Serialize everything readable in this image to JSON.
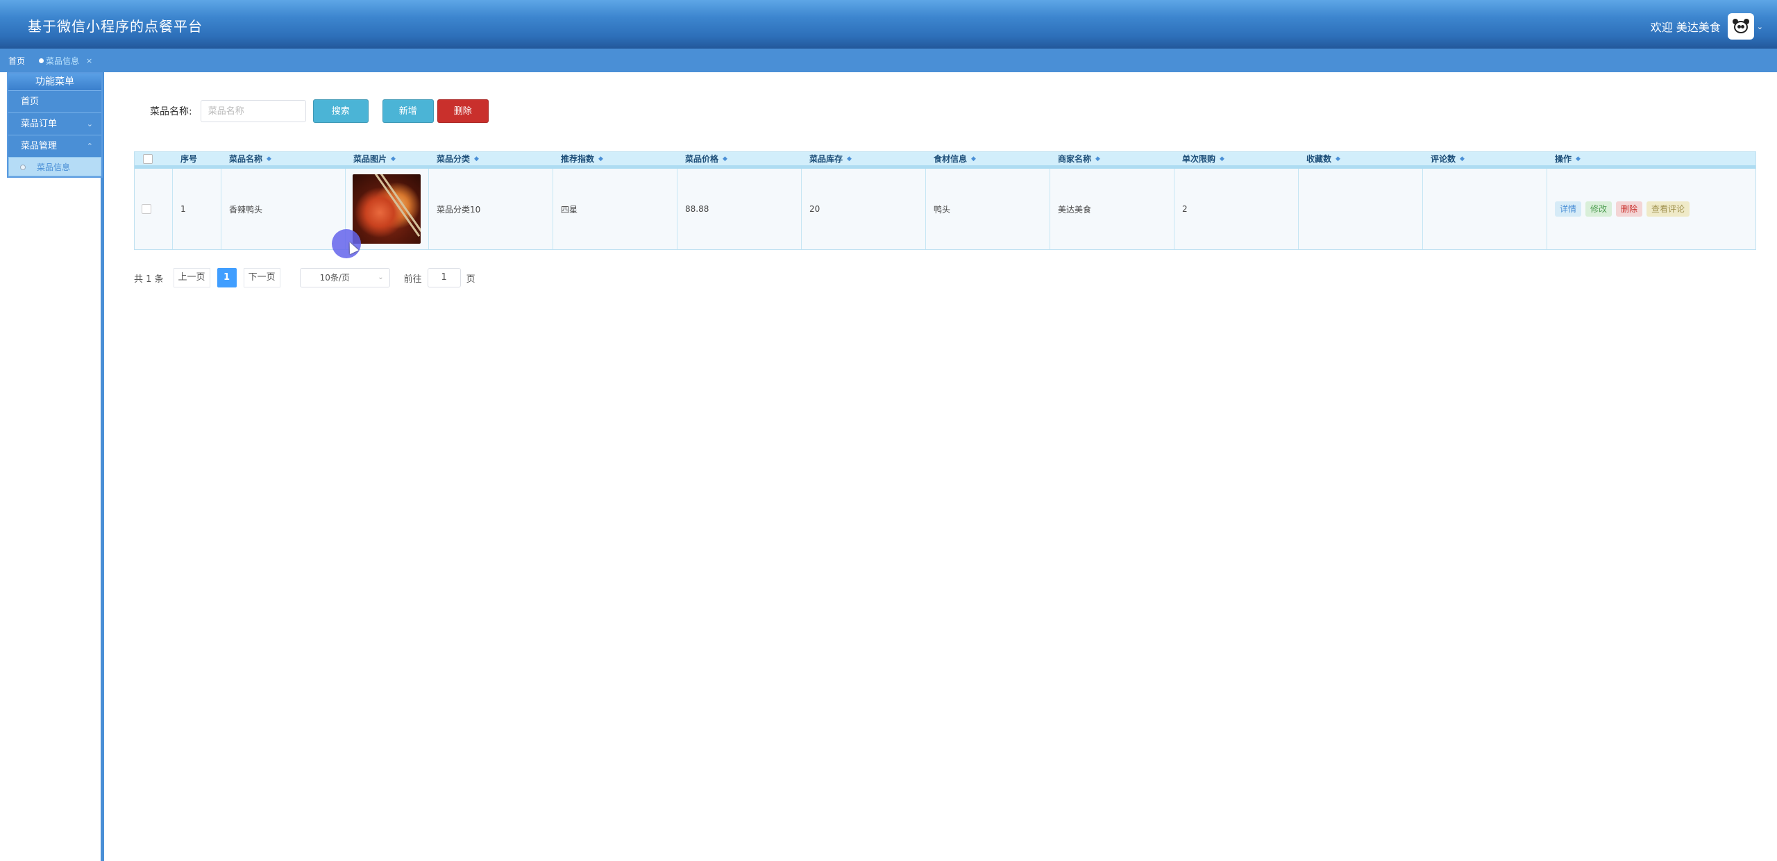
{
  "header": {
    "app_title": "基于微信小程序的点餐平台",
    "welcome_text": "欢迎 美达美食",
    "user_caret": "⌄"
  },
  "tabs": [
    {
      "label": "首页"
    },
    {
      "label": "菜品信息",
      "close": "×"
    }
  ],
  "sidebar": {
    "title": "功能菜单",
    "items": [
      {
        "label": "首页",
        "chevron": ""
      },
      {
        "label": "菜品订单",
        "chevron": "⌄"
      },
      {
        "label": "菜品管理",
        "chevron": "⌃"
      }
    ],
    "sub_items": [
      {
        "label": "菜品信息"
      }
    ]
  },
  "search": {
    "label": "菜品名称:",
    "placeholder": "菜品名称",
    "search_button": "搜索",
    "add_button": "新增",
    "delete_button": "删除"
  },
  "table": {
    "sort_glyph": "◆",
    "columns": [
      "序号",
      "菜品名称",
      "菜品图片",
      "菜品分类",
      "推荐指数",
      "菜品价格",
      "菜品库存",
      "食材信息",
      "商家名称",
      "单次限购",
      "收藏数",
      "评论数",
      "操作"
    ],
    "rows": [
      {
        "index": "1",
        "name": "香辣鸭头",
        "category": "菜品分类10",
        "recommend": "四星",
        "price": "88.88",
        "stock": "20",
        "ingredients": "鸭头",
        "merchant": "美达美食",
        "limit": "2",
        "favorites": "",
        "comments": ""
      }
    ],
    "actions": {
      "detail": "详情",
      "edit": "修改",
      "delete": "删除",
      "view_comments": "查看评论"
    }
  },
  "pagination": {
    "total": "共 1 条",
    "prev": "上一页",
    "current": "1",
    "next": "下一页",
    "page_size": "10条/页",
    "goto_label": "前往",
    "goto_value": "1",
    "goto_unit": "页"
  }
}
